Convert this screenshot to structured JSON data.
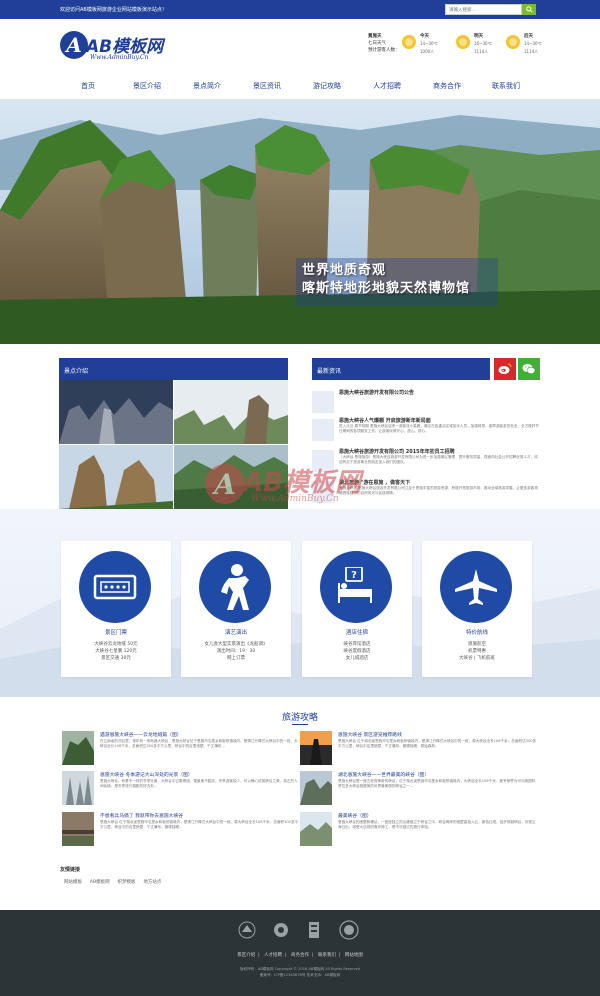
{
  "topbar": {
    "welcome": "欢迎访问AB模板网旅游企业网站模板演示站点！",
    "search_placeholder": "请输入搜索..."
  },
  "logo": {
    "name": "AB模板网",
    "url": "Www.AdminBuy.Cn"
  },
  "weather": {
    "intro": [
      "景施天",
      "七日天气",
      "预计游客人数："
    ],
    "days": [
      {
        "label": "今天",
        "temp": "14~30℃",
        "count": "1000人"
      },
      {
        "label": "明天",
        "temp": "16~30℃",
        "count": "1114人"
      },
      {
        "label": "后天",
        "temp": "14~30℃",
        "count": "1114人"
      }
    ]
  },
  "nav": [
    "首页",
    "景区介绍",
    "景点简介",
    "景区资讯",
    "游记攻略",
    "人才招聘",
    "商务合作",
    "联系我们"
  ],
  "banner": {
    "slogan": [
      "世界地质奇观",
      "喀斯特地形地貌天然博物馆"
    ]
  },
  "spots": {
    "title": "景点介绍"
  },
  "news": {
    "title": "最新资讯",
    "items": [
      {
        "title": "恩施大峡谷旅游开发有限公司公告",
        "desc": ""
      },
      {
        "title": "恩施大峡谷人气爆棚 开启旅游新年新局面",
        "desc": "进入元旦 春节前期 恩施大峡谷迎来一波客流小高峰，景区在各重点区域加派人员，加强疏导，保障游客游览安全，全力做好节日期间的各项服务工作，让游客玩得开心、放心、舒心。"
      },
      {
        "title": "恩施大峡谷旅游开发有限公司 2015年年初员工招聘",
        "desc": "（大峡谷 恩施旅游）恩施大峡谷旅游开发有限公司为进一步加强景区管理，提升服务质量，现面向社会公开招聘优秀人才，欢迎有志于旅游事业的朋友加入我们的团队。"
      },
      {
        "title": "湖北旅游 \"游在恩施 ，做客天下",
        "desc": "恩施大峡谷 恩施大峡谷旅游开发有限公司立足于恩施丰富的旅游资源，积极开拓旅游市场，推动全域旅游发展，让更多游客领略恩施独特的自然风光与民族风情。"
      }
    ]
  },
  "features": [
    {
      "title": "景区门票",
      "icon": "ticket-icon",
      "lines": [
        "大峡谷云龙地缝 50元",
        "大峡谷七星寨 120元",
        "景区交通 30元"
      ]
    },
    {
      "title": "演艺演出",
      "icon": "performance-icon",
      "lines": [
        "女儿会大型实景演出《龙船调》",
        "演出时间：19：30",
        "网上订票"
      ]
    },
    {
      "title": "酒店住宿",
      "icon": "hotel-icon",
      "lines": [
        "峡谷宾馆酒店",
        "峡谷度假酒店",
        "女儿城酒店"
      ]
    },
    {
      "title": "特价航线",
      "icon": "plane-icon",
      "lines": [
        "恩施航空",
        "机票特惠",
        "大峡谷 | 飞机航班"
      ]
    }
  ],
  "guides": {
    "title": "旅游攻略",
    "items": [
      {
        "title": "遇游恩施大峡谷——云龙地缝篇（图）",
        "desc": "在云南省的河谷里，常年有一条地缝大峡谷，恩施大峡谷位于恩施市屯堡乡和板桥镇境内，是清江升降式大峡谷中的一段，大峡谷全长108千米，总面积达300多平方公里，峡谷中的百里绝壁、千丈瀑布..."
      },
      {
        "title": "恩施大峡谷 景区游览推荐路线",
        "desc": "恩施大峡谷 位于湖北省恩施市屯堡乡和板桥镇境内，是清江升降式大峡谷中的一段，原大峡谷全长108千米，总面积达300多平方公里，峡谷中百里绝壁、千丈瀑布、傲啸独峰、原始森林。"
      },
      {
        "title": "恩施大峡谷 冬季游记大山深处的光景（图）",
        "desc": "恩施大峡谷，有着不一样的冬季光景，大峡谷中云雾缭绕，雪景美不胜收，冬季游客较少，可以静心欣赏峡谷之美，真正的人间仙境，是冬季旅行摄影的好去处..."
      },
      {
        "title": "湖北恩施大峡谷——世界最美的峡谷（图）",
        "desc": "恩施大峡谷是一座古老而神奇的峡谷，位于湖北省恩施市屯堡乡和板桥镇境内，大峡谷全长108千米，被专家誉为可与美国科罗拉多大峡谷相媲美的世界最美丽的峡谷之一..."
      },
      {
        "title": "不想看兵马俑了 我就带你去恩施大峡谷",
        "desc": "恩施大峡谷 位于湖北省恩施市屯堡乡和板桥镇境内，是清江升降式大峡谷中的一段。原大峡谷全长108千米，总面积300多平方公里，峡谷中的百里绝壁、千丈瀑布、傲啸独峰..."
      },
      {
        "title": "最美峡谷（图）",
        "desc": "恩施大峡谷的绝壁和峰丛，一座座独立的山峰矗立于峡谷之中，峡谷两岸的绝壁高耸入云，景色壮观。徒步穿越峡谷，欣赏云海日出，感受大自然的鬼斧神工，是不可错过的旅行体验。"
      }
    ]
  },
  "friend_links": {
    "title": "友情链接",
    "items": [
      "网站模板",
      "AB模板网",
      "织梦模板",
      "地方站点"
    ]
  },
  "footer": {
    "nav": [
      "景区介绍",
      "人才招聘",
      "商务合作",
      "联系我们",
      "网站地图"
    ],
    "copyright": "版权所有：AB模板网 Copyright © 2016 AB模板网 All Rights Reserved",
    "icp": "备案号：ICP备12345678号  技术支持：AB模板网"
  },
  "watermark": {
    "name": "AB模板网",
    "url": "Www.AdminBuy.Cn"
  },
  "colors": {
    "primary": "#1f3f99",
    "footer": "#2c3438",
    "search_btn": "#7bbb2c",
    "weibo": "#d7282c",
    "wechat": "#3eb135"
  }
}
